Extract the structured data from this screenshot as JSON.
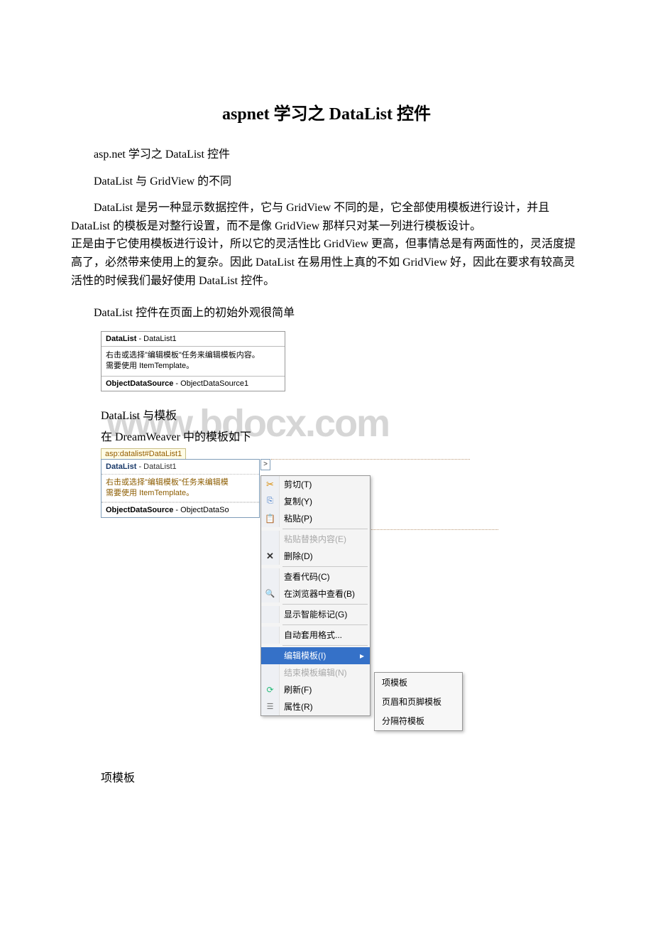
{
  "title": "aspnet 学习之 DataList 控件",
  "p1": "asp.net 学习之 DataList 控件",
  "p2": "DataList 与 GridView 的不同",
  "p3": "DataList 是另一种显示数据控件，它与 GridView 不同的是，它全部使用模板进行设计，并且 DataList 的模板是对整行设置，而不是像 GridView 那样只对某一列进行模板设计。\n正是由于它使用模板进行设计，所以它的灵活性比 GridView 更高，但事情总是有两面性的，灵活度提高了，必然带来使用上的复杂。因此 DataList 在易用性上真的不如 GridView 好，因此在要求有较高灵活性的时候我们最好使用 DataList 控件。",
  "p4": "DataList 控件在页面上的初始外观很简单",
  "panel1": {
    "titleBold": "DataList",
    "titleRest": " - DataList1",
    "help": "右击或选择\"编辑模板\"任务来编辑模板内容。\n需要使用 ItemTemplate。",
    "odsBold": "ObjectDataSource",
    "odsRest": " - ObjectDataSource1"
  },
  "p5": "DataList 与模板",
  "p6": "在 DreamWeaver 中的模板如下",
  "watermark": "www.bdocx.com",
  "panel2": {
    "tagTab": "asp:datalist#DataList1",
    "titleBold": "DataList",
    "titleRest": " - DataList1",
    "help": "右击或选择\"编辑模板\"任务来编辑模\n需要使用 ItemTemplate。",
    "odsBold": "ObjectDataSource",
    "odsRest": " - ObjectDataSo",
    "smartArrow": ">"
  },
  "contextMenu": {
    "items": [
      {
        "icon": "scissors",
        "label": "剪切(T)",
        "disabled": false
      },
      {
        "icon": "copy",
        "label": "复制(Y)",
        "disabled": false
      },
      {
        "icon": "paste",
        "label": "粘贴(P)",
        "disabled": false
      },
      {
        "sep": true
      },
      {
        "icon": "",
        "label": "粘贴替换内容(E)",
        "disabled": true
      },
      {
        "icon": "delete",
        "label": "删除(D)",
        "disabled": false
      },
      {
        "sep": true
      },
      {
        "icon": "",
        "label": "查看代码(C)",
        "disabled": false
      },
      {
        "icon": "browse",
        "label": "在浏览器中查看(B)",
        "disabled": false
      },
      {
        "sep": true
      },
      {
        "icon": "",
        "label": "显示智能标记(G)",
        "disabled": false
      },
      {
        "sep": true
      },
      {
        "icon": "",
        "label": "自动套用格式...",
        "disabled": false
      },
      {
        "sep": true
      },
      {
        "icon": "",
        "label": "编辑模板(I)",
        "selected": true,
        "hasSub": true
      },
      {
        "icon": "",
        "label": "结束模板编辑(N)",
        "disabled": true
      },
      {
        "icon": "refresh",
        "label": "刷新(F)",
        "disabled": false
      },
      {
        "icon": "prop",
        "label": "属性(R)",
        "disabled": false
      }
    ]
  },
  "submenu": {
    "items": [
      "项模板",
      "页眉和页脚模板",
      "分隔符模板"
    ]
  },
  "p7": "项模板"
}
